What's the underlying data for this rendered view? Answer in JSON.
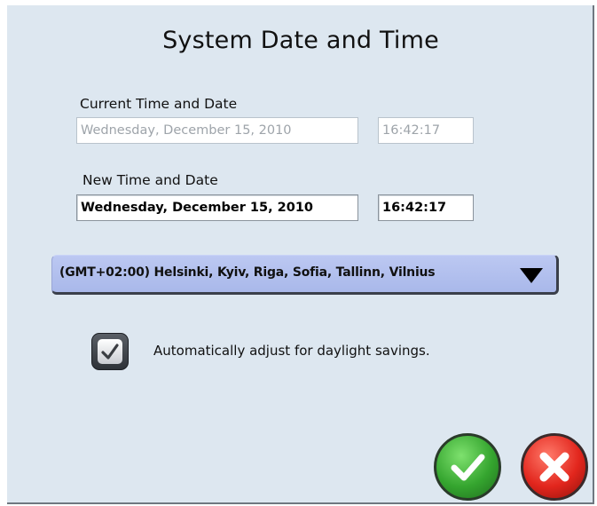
{
  "dialog": {
    "title": "System Date and Time",
    "current": {
      "label": "Current Time and Date",
      "date": "Wednesday, December 15, 2010",
      "time": "16:42:17"
    },
    "new": {
      "label": "New Time and Date",
      "date": "Wednesday, December 15, 2010",
      "time": "16:42:17"
    },
    "timezone": {
      "selected": "(GMT+02:00) Helsinki, Kyiv, Riga, Sofia, Tallinn, Vilnius",
      "icon": "triangle-down-icon"
    },
    "daylight": {
      "label": "Automatically adjust for daylight savings.",
      "checked": true,
      "icon": "checkmark-icon"
    },
    "buttons": {
      "ok_icon": "checkmark-icon",
      "cancel_icon": "x-icon"
    }
  },
  "colors": {
    "background": "#dde7f0",
    "dropdown": "#b2c0ee",
    "ok": "#35a52f",
    "cancel": "#e2261d"
  }
}
